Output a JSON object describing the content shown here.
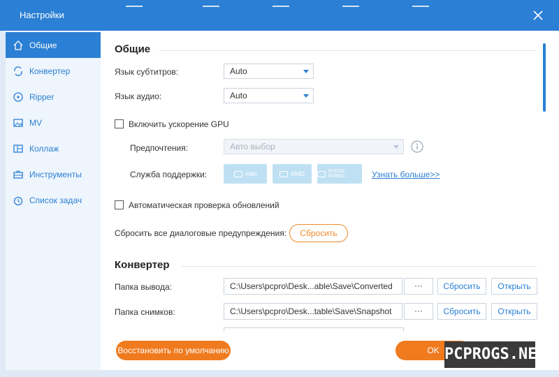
{
  "window": {
    "title": "Настройки"
  },
  "colors": {
    "accent": "#2b7fd4",
    "orange": "#f07a1e",
    "sidebar_bg": "#eef5fc"
  },
  "sidebar": {
    "items": [
      {
        "label": "Общие",
        "icon": "home-icon",
        "active": true
      },
      {
        "label": "Конвертер",
        "icon": "convert-icon",
        "active": false
      },
      {
        "label": "Ripper",
        "icon": "disc-icon",
        "active": false
      },
      {
        "label": "MV",
        "icon": "image-icon",
        "active": false
      },
      {
        "label": "Коллаж",
        "icon": "collage-icon",
        "active": false
      },
      {
        "label": "Инструменты",
        "icon": "toolbox-icon",
        "active": false
      },
      {
        "label": "Список задач",
        "icon": "clock-icon",
        "active": false
      }
    ]
  },
  "general": {
    "title": "Общие",
    "subtitle_language_label": "Язык субтитров:",
    "subtitle_language_value": "Auto",
    "audio_language_label": "Язык аудио:",
    "audio_language_value": "Auto",
    "gpu_label": "Включить ускорение GPU",
    "preferences_label": "Предпочтения:",
    "preferences_value": "Авто выбор",
    "support_label": "Служба поддержки:",
    "gpu_vendors": [
      "intel",
      "AMD",
      "NVIDIA NVENC"
    ],
    "learn_more": "Узнать больше>>",
    "auto_update_label": "Автоматическая проверка обновлений",
    "reset_warnings_label": "Сбросить все диалоговые предупреждения:",
    "reset_button": "Сбросить"
  },
  "converter": {
    "title": "Конвертер",
    "output_folder_label": "Папка вывода:",
    "output_folder_value": "C:\\Users\\pcpro\\Desk...able\\Save\\Converted",
    "snapshot_folder_label": "Папка снимков:",
    "snapshot_folder_value": "C:\\Users\\pcpro\\Desk...table\\Save\\Snapshot",
    "browse_label": "···",
    "browse_button": "Сбросить",
    "open_button": "Открыть"
  },
  "footer": {
    "restore_defaults": "Восстановить по умолчанию",
    "ok": "OK"
  },
  "watermark": "PCPROGS.NET"
}
